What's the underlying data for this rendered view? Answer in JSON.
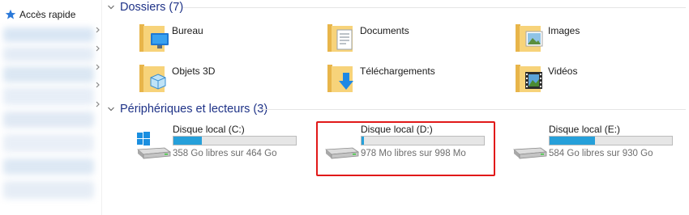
{
  "nav": {
    "quick_access_label": "Accès rapide"
  },
  "folders_group": {
    "title": "Dossiers (7)",
    "items": [
      {
        "label": "Bureau",
        "icon": "desktop-folder-icon"
      },
      {
        "label": "Documents",
        "icon": "documents-folder-icon"
      },
      {
        "label": "Images",
        "icon": "pictures-folder-icon"
      },
      {
        "label": "Objets 3D",
        "icon": "3d-objects-folder-icon"
      },
      {
        "label": "Téléchargements",
        "icon": "downloads-folder-icon"
      },
      {
        "label": "Vidéos",
        "icon": "videos-folder-icon"
      }
    ]
  },
  "devices_group": {
    "title": "Périphériques et lecteurs (3)",
    "drives": [
      {
        "name": "Disque local (C:)",
        "free_text": "358 Go libres sur 464 Go",
        "used_fraction": 0.23,
        "icon": "windows-drive-icon"
      },
      {
        "name": "Disque local (D:)",
        "free_text": "978 Mo libres sur 998 Mo",
        "used_fraction": 0.02,
        "icon": "hard-drive-icon"
      },
      {
        "name": "Disque local (E:)",
        "free_text": "584 Go libres sur 930 Go",
        "used_fraction": 0.37,
        "icon": "hard-drive-icon"
      }
    ]
  },
  "colors": {
    "accent": "#26a0da",
    "group_title": "#1e3287",
    "highlight": "#e11919"
  }
}
